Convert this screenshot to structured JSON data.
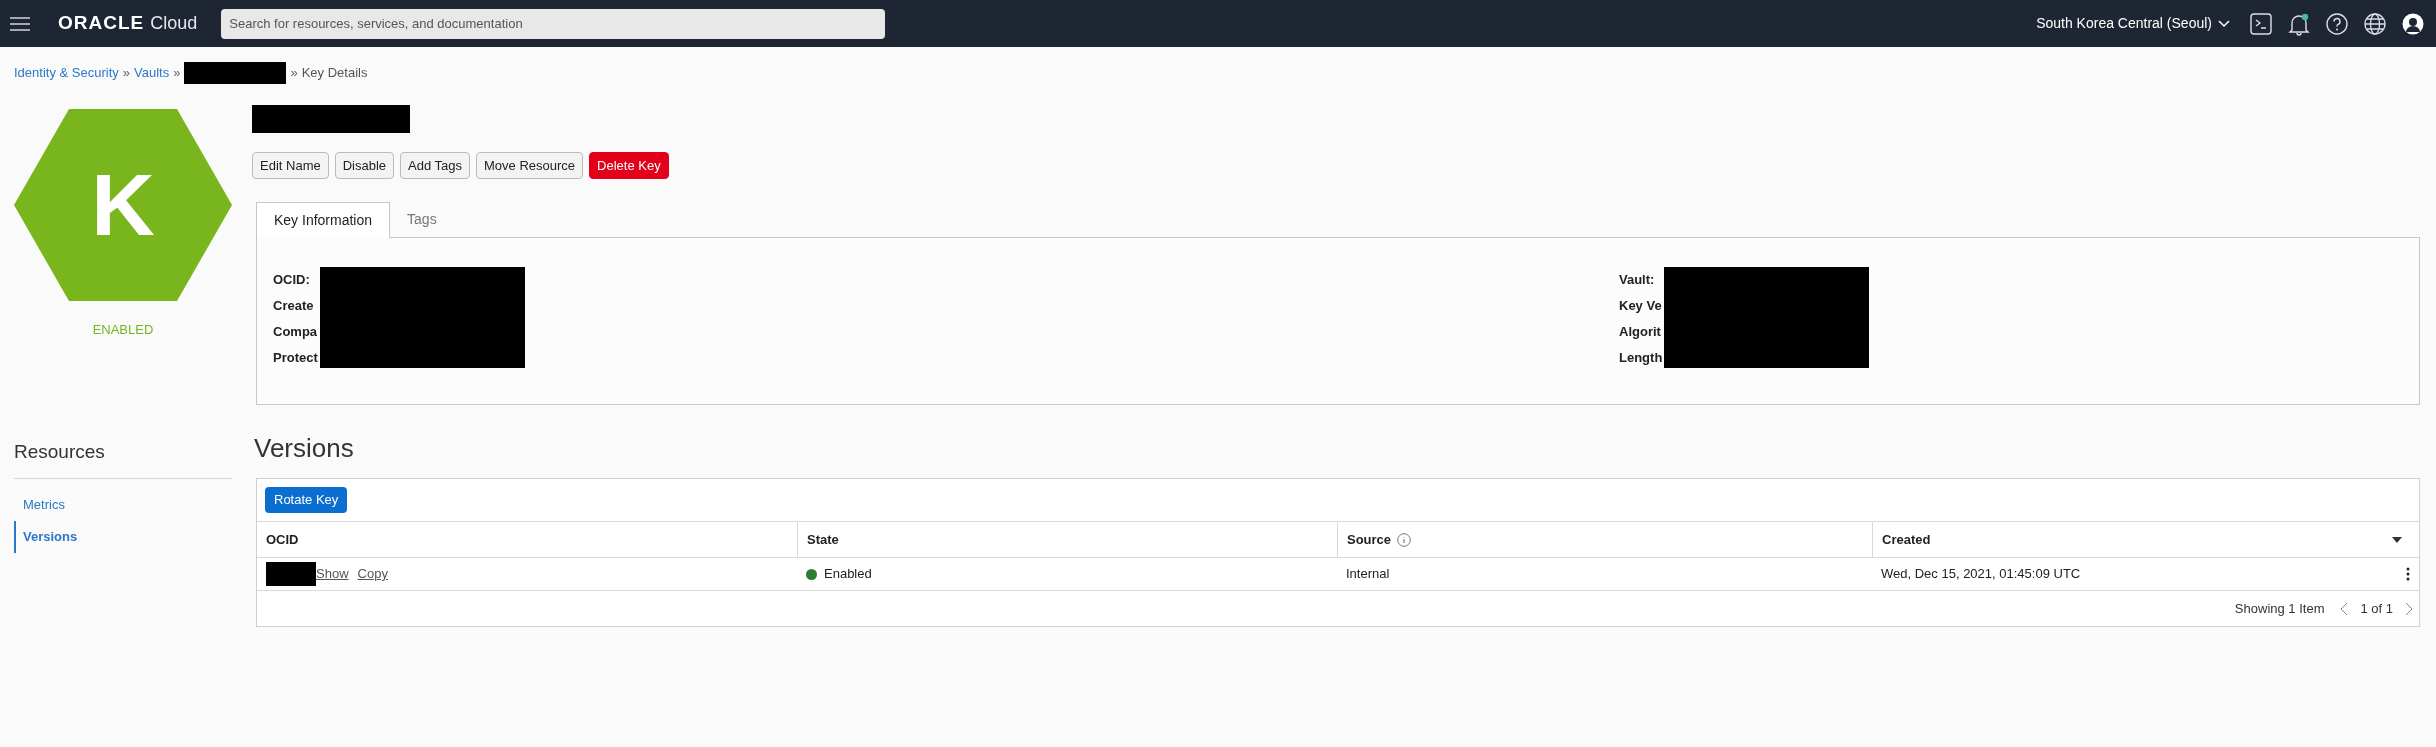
{
  "header": {
    "logo_brand": "ORACLE",
    "logo_product": "Cloud",
    "search": {
      "placeholder": "Search for resources, services, and documentation"
    },
    "region": "South Korea Central (Seoul)"
  },
  "breadcrumb": {
    "separator": "»",
    "items": [
      {
        "kind": "link",
        "label": "Identity & Security"
      },
      {
        "kind": "link",
        "label": "Vaults"
      },
      {
        "kind": "redacted"
      },
      {
        "kind": "current",
        "label": "Key Details"
      }
    ]
  },
  "key_badge": {
    "letter": "K",
    "status": "ENABLED",
    "kind": "enabled"
  },
  "actions": [
    {
      "label": "Edit Name",
      "kind": "default"
    },
    {
      "label": "Disable",
      "kind": "default"
    },
    {
      "label": "Add Tags",
      "kind": "default"
    },
    {
      "label": "Move Resource",
      "kind": "default"
    },
    {
      "label": "Delete Key",
      "kind": "danger"
    }
  ],
  "tabs": [
    {
      "label": "Key Information",
      "selected": true
    },
    {
      "label": "Tags",
      "selected": false
    }
  ],
  "info": {
    "left": [
      "OCID:",
      "Create",
      "Compa",
      "Protect"
    ],
    "right": [
      "Vault:",
      "Key Ve",
      "Algorit",
      "Length"
    ]
  },
  "resources": {
    "title": "Resources",
    "items": [
      {
        "label": "Metrics",
        "selected": false
      },
      {
        "label": "Versions",
        "selected": true
      }
    ]
  },
  "versions": {
    "title": "Versions",
    "primary_button": "Rotate Key",
    "columns": [
      {
        "label": "OCID",
        "kind": "plain"
      },
      {
        "label": "State",
        "kind": "plain"
      },
      {
        "label": "Source",
        "kind": "info"
      },
      {
        "label": "Created",
        "kind": "sort"
      }
    ],
    "rows": [
      {
        "links": [
          "Show",
          "Copy"
        ],
        "state": "Enabled",
        "color": "#2e7d32",
        "source": "Internal",
        "created": "Wed, Dec 15, 2021, 01:45:09 UTC"
      }
    ],
    "footer": {
      "count": "Showing 1 Item",
      "page": "1 of 1"
    }
  }
}
